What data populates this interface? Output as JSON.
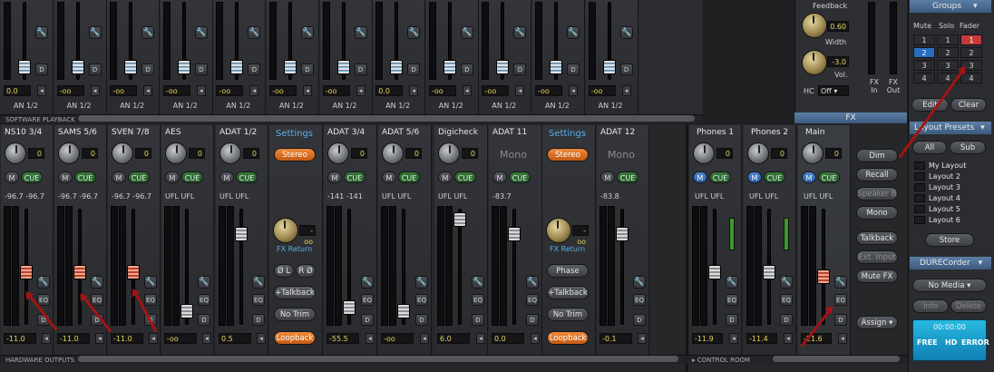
{
  "software_playback": {
    "section_label": "SOFTWARE PLAYBACK",
    "channels": [
      {
        "level": "0.0",
        "routing": "AN 1/2"
      },
      {
        "level": "-oo",
        "routing": "AN 1/2"
      },
      {
        "level": "-oo",
        "routing": "AN 1/2"
      },
      {
        "level": "-oo",
        "routing": "AN 1/2"
      },
      {
        "level": "-oo",
        "routing": "AN 1/2"
      },
      {
        "level": "-oo",
        "routing": "AN 1/2"
      },
      {
        "level": "-oo",
        "routing": "AN 1/2"
      },
      {
        "level": "0.0",
        "routing": "AN 1/2"
      },
      {
        "level": "-oo",
        "routing": "AN 1/2"
      },
      {
        "level": "-oo",
        "routing": "AN 1/2"
      },
      {
        "level": "-oo",
        "routing": "AN 1/2"
      },
      {
        "level": "-oo",
        "routing": "AN 1/2"
      }
    ]
  },
  "hardware_outputs": {
    "section_label": "HARDWARE OUTPUTS",
    "channels": [
      {
        "name": "NS10 3/4",
        "gain": "0",
        "levels": "-96.7 -96.7",
        "fader_value": "-11.0",
        "fader_pct": 45,
        "style": "red"
      },
      {
        "name": "SAMS 5/6",
        "gain": "0",
        "levels": "-96.7 -96.7",
        "fader_value": "-11.0",
        "fader_pct": 45,
        "style": "red"
      },
      {
        "name": "SVEN 7/8",
        "gain": "0",
        "levels": "-96.7 -96.7",
        "fader_value": "-11.0",
        "fader_pct": 45,
        "style": "red"
      },
      {
        "name": "AES",
        "gain": "0",
        "levels": "UFL UFL",
        "fader_value": "-oo",
        "fader_pct": 6,
        "style": "grey"
      },
      {
        "name": "ADAT 1/2",
        "gain": "0",
        "levels": "UFL UFL",
        "fader_value": "0.5",
        "fader_pct": 82,
        "style": "grey"
      }
    ],
    "settings_a": {
      "title": "Settings",
      "stereo": "Stereo",
      "fx_return": "FX Return",
      "knob_value": "-oo",
      "phase_l": "Ø L",
      "phase_r": "R Ø",
      "talkback": "+Talkback",
      "no_trim": "No Trim",
      "loopback": "Loopback"
    },
    "channels_b": [
      {
        "name": "ADAT 3/4",
        "gain": "0",
        "levels": "-141 -141",
        "fader_value": "-55.5",
        "fader_pct": 10,
        "style": "grey"
      },
      {
        "name": "ADAT 5/6",
        "gain": "0",
        "levels": "UFL UFL",
        "fader_value": "-oo",
        "fader_pct": 6,
        "style": "grey"
      },
      {
        "name": "Digicheck",
        "gain": "0",
        "levels": "UFL UFL",
        "fader_value": "6.0",
        "fader_pct": 96,
        "style": "grey"
      },
      {
        "name": "ADAT 11",
        "mono": "Mono",
        "levels": "-83.7",
        "fader_value": "0.0",
        "fader_pct": 82,
        "style": "grey"
      }
    ],
    "settings_b": {
      "title": "Settings",
      "stereo": "Stereo",
      "fx_return": "FX Return",
      "knob_value": "-oo",
      "phase": "Phase",
      "talkback": "+Talkback",
      "no_trim": "No Trim",
      "loopback": "Loopback"
    },
    "channel_last": {
      "name": "ADAT 12",
      "mono": "Mono",
      "levels": "-83.8",
      "fader_value": "-0.1",
      "fader_pct": 82,
      "style": "grey"
    },
    "m_label": "M",
    "cue_label": "CUE",
    "eq_label": "EQ",
    "d_label": "D"
  },
  "control_room": {
    "section_label": "CONTROL ROOM",
    "phones1": {
      "name": "Phones 1",
      "gain": "0",
      "levels": "UFL UFL",
      "fader_value": "-11.9",
      "fader_pct": 45
    },
    "phones2": {
      "name": "Phones 2",
      "gain": "0",
      "levels": "UFL UFL",
      "fader_value": "-11.4",
      "fader_pct": 45
    },
    "main": {
      "name": "Main",
      "gain": "0",
      "levels": "UFL UFL",
      "fader_value": "-21.6",
      "fader_pct": 40
    },
    "buttons": {
      "dim": "Dim",
      "recall": "Recall",
      "speaker_b": "Speaker B",
      "mono": "Mono",
      "talkback": "Talkback",
      "ext_input": "Ext. Input",
      "mute_fx": "Mute FX",
      "assign": "Assign"
    }
  },
  "fx": {
    "label": "FX",
    "feedback_label": "Feedback",
    "feedback_value": "0.60",
    "width_label": "Width",
    "vol_value": "-3.0",
    "vol_label": "Vol.",
    "hc_label": "HC",
    "hc_value": "Off",
    "fx_in": "FX In",
    "fx_out": "FX Out"
  },
  "groups": {
    "title": "Groups",
    "headers": [
      "Mute",
      "Solo",
      "Fader"
    ],
    "rows": [
      [
        "1",
        "1",
        "1"
      ],
      [
        "2",
        "2",
        "2"
      ],
      [
        "3",
        "3",
        "3"
      ],
      [
        "4",
        "4",
        "4"
      ]
    ],
    "edit": "Edit",
    "clear": "Clear"
  },
  "layout_presets": {
    "title": "Layout Presets",
    "all": "All",
    "sub": "Sub",
    "items": [
      "My Layout",
      "Layout 2",
      "Layout 3",
      "Layout 4",
      "Layout 5",
      "Layout 6"
    ],
    "store": "Store"
  },
  "durecorder": {
    "title": "DURECorder",
    "media": "No Media",
    "info": "Info",
    "delete": "Delete",
    "time": "00:00:00",
    "free": "FREE",
    "hd": "HD",
    "error": "ERROR"
  }
}
